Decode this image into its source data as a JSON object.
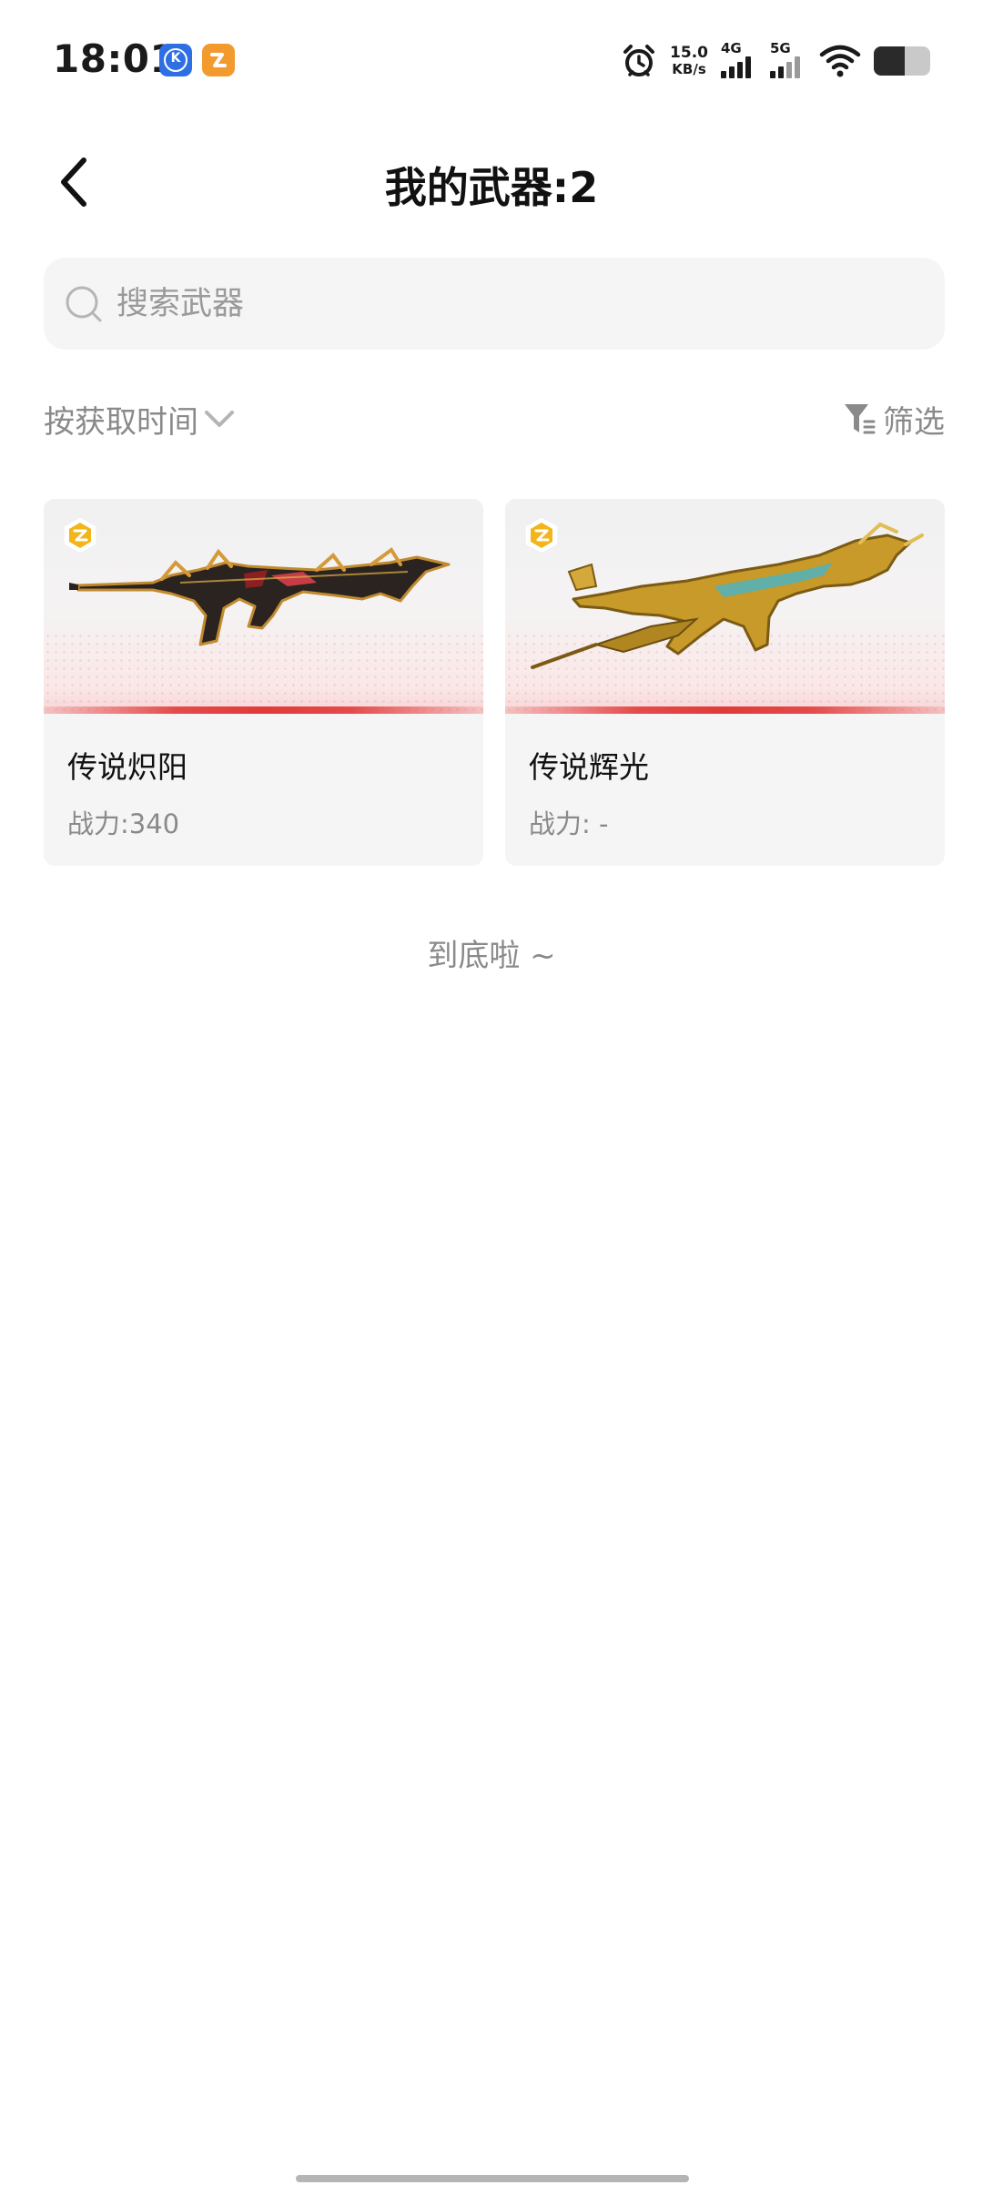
{
  "status_bar": {
    "time": "18:01",
    "net_speed_value": "15.0",
    "net_speed_unit": "KB/s",
    "signal_1_label": "4G",
    "signal_2_label": "5G",
    "battery_level": 0.55,
    "icons": [
      "app-k-icon",
      "app-orange-icon",
      "alarm-icon",
      "signal-icon",
      "wifi-icon",
      "battery-icon"
    ]
  },
  "header": {
    "title": "我的武器:2"
  },
  "search": {
    "placeholder": "搜索武器"
  },
  "sort": {
    "label": "按获取时间"
  },
  "filter": {
    "label": "筛选"
  },
  "weapons": [
    {
      "name": "传说炽阳",
      "power": "战力:340"
    },
    {
      "name": "传说辉光",
      "power": "战力: -"
    }
  ],
  "footer": {
    "end_text": "到底啦 ~"
  },
  "colors": {
    "background": "#ffffff",
    "card_background": "#f5f5f5",
    "accent_red": "#e03a3a",
    "muted_text": "#8a8a8a",
    "badge_gold": "#f2b51a"
  }
}
